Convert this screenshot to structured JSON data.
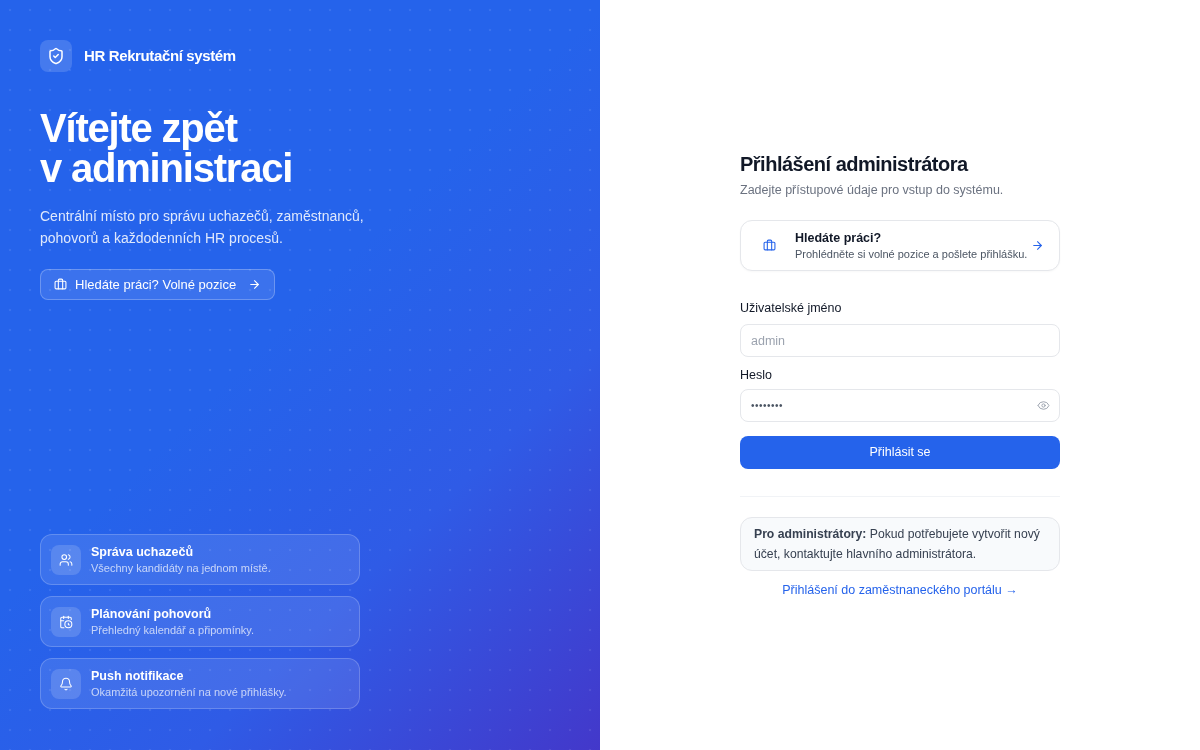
{
  "brand": {
    "name": "HR Rekrutační systém"
  },
  "hero": {
    "title_lines": [
      "Vítejte zpět",
      "v administraci"
    ],
    "subtitle": "Centrální místo pro správu uchazečů, zaměstnanců, pohovorů a každodenních HR procesů.",
    "job_button": {
      "label": "Hledáte práci? Volné pozice"
    }
  },
  "features": [
    {
      "title": "Správa uchazečů",
      "description": "Všechny kandidáty na jednom místě."
    },
    {
      "title": "Plánování pohovorů",
      "description": "Přehledný kalendář a připomínky."
    },
    {
      "title": "Push notifikace",
      "description": "Okamžitá upozornění na nové přihlášky."
    }
  ],
  "login": {
    "title": "Přihlášení administrátora",
    "subtitle": "Zadejte přístupové údaje pro vstup do systému.",
    "job_card": {
      "title": "Hledáte práci?",
      "description": "Prohlédněte si volné pozice a pošlete přihlášku."
    },
    "username": {
      "label": "Uživatelské jméno",
      "placeholder": "admin"
    },
    "password": {
      "label": "Heslo",
      "value": "••••••••"
    },
    "submit": {
      "label": "Přihlásit se"
    },
    "notice": "**Pro administrátory:** Pokud potřebujete vytvořit nový účet, kontaktujte hlavního administrátora.",
    "employee_link": "Přihlášení do zaměstnaneckého portálu →"
  }
}
